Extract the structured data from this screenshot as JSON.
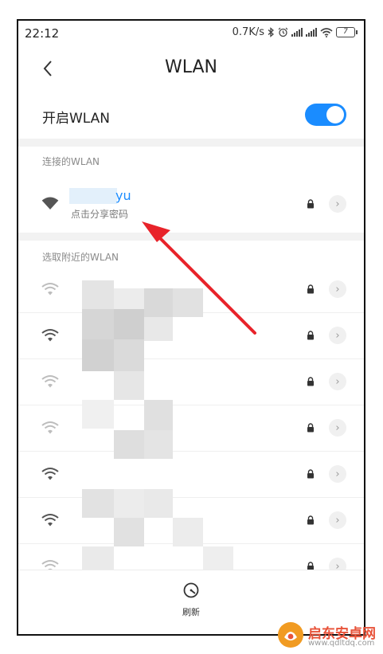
{
  "status": {
    "time": "22:12",
    "speed": "0.7K/s",
    "battery": "7"
  },
  "header": {
    "title": "WLAN"
  },
  "toggle": {
    "label": "开启WLAN",
    "on": true
  },
  "connected": {
    "header": "连接的WLAN",
    "name": "yu",
    "subtitle": "点击分享密码"
  },
  "nearby": {
    "header": "选取附近的WLAN",
    "rows": 7
  },
  "bottom": {
    "refresh_label": "刷新"
  },
  "watermark": {
    "name": "启东安卓网",
    "url": "www.qdltdq.com"
  },
  "colors": {
    "accent": "#1a8cff",
    "annotation_arrow": "#e8232a"
  },
  "icons": [
    "back-arrow-icon",
    "bluetooth-icon",
    "alarm-icon",
    "signal-icon",
    "wifi-icon",
    "battery-icon",
    "lock-icon",
    "chevron-right-icon",
    "refresh-icon"
  ]
}
